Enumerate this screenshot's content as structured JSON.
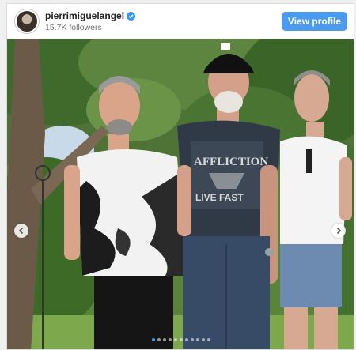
{
  "profile": {
    "username": "pierrimiguelangel",
    "followers": "15.7K followers",
    "view_profile_label": "View profile",
    "verified_color": "#3897f0"
  },
  "post": {
    "shirt_center_text": "AFFLICTION",
    "shirt_bottom_text": "LIVE FAST",
    "carousel": {
      "count": 11,
      "active_index": 0
    }
  },
  "icons": {
    "prev": "chevron-left-icon",
    "next": "chevron-right-icon",
    "verified": "verified-badge-icon"
  },
  "colors": {
    "button": "#4a9af0",
    "username": "#262626",
    "meta": "#737373"
  }
}
